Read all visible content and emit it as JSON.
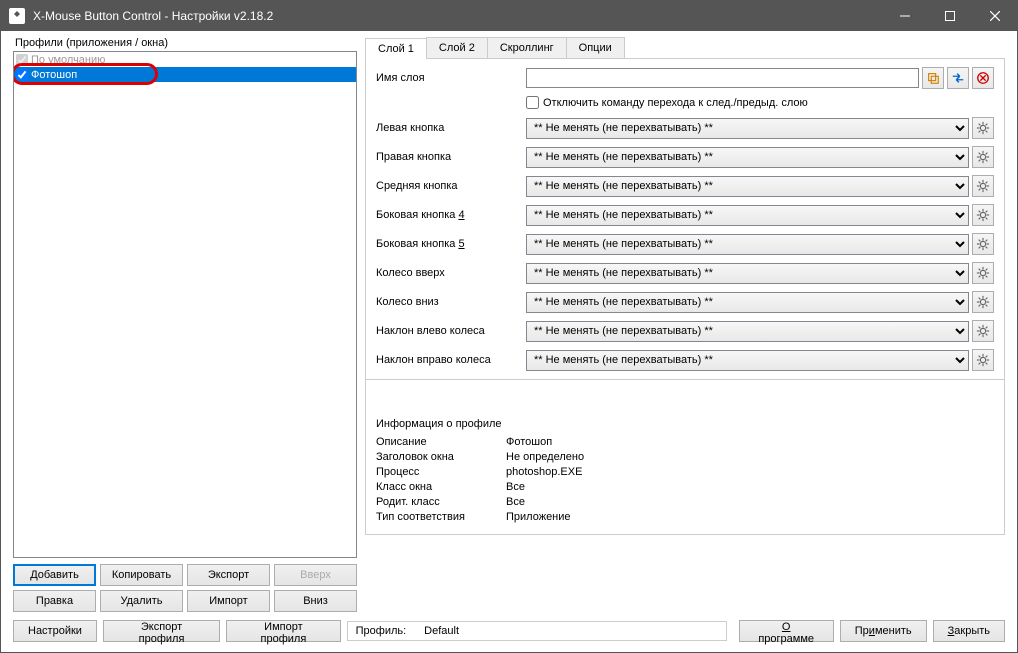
{
  "window": {
    "title": "X-Mouse Button Control - Настройки v2.18.2"
  },
  "left": {
    "label": "Профили (приложения / окна)",
    "items": {
      "default": "По умолчанию",
      "selected": "Фотошоп"
    },
    "buttons": {
      "add": "Добавить",
      "copy": "Копировать",
      "export": "Экспорт",
      "up": "Вверх",
      "edit": "Правка",
      "delete": "Удалить",
      "import": "Импорт",
      "down": "Вниз"
    }
  },
  "tabs": {
    "t1": "Слой 1",
    "t2": "Слой 2",
    "t3": "Скроллинг",
    "t4": "Опции"
  },
  "layer": {
    "name_label": "Имя слоя",
    "disable_cmd": "Отключить команду перехода к след./предыд. слою",
    "rows": {
      "left": "Левая кнопка",
      "right": "Правая кнопка",
      "middle": "Средняя кнопка",
      "side4_pre": "Боковая кнопка ",
      "side4_u": "4",
      "side5_pre": "Боковая кнопка ",
      "side5_u": "5",
      "wheel_up": "Колесо вверх",
      "wheel_down": "Колесо вниз",
      "tilt_left": "Наклон влево колеса",
      "tilt_right": "Наклон вправо колеса"
    },
    "combo_default": "** Не менять (не перехватывать) **"
  },
  "info": {
    "title": "Информация о профиле",
    "rows": {
      "desc_l": "Описание",
      "desc_v": "Фотошоп",
      "wtitle_l": "Заголовок окна",
      "wtitle_v": "Не определено",
      "proc_l": "Процесс",
      "proc_v": "photoshop.EXE",
      "wclass_l": "Класс окна",
      "wclass_v": "Все",
      "pclass_l": "Родит. класс",
      "pclass_v": "Все",
      "match_l": "Тип соответствия",
      "match_v": "Приложение"
    }
  },
  "bottom": {
    "settings": "Настройки",
    "export_profile": "Экспорт профиля",
    "import_profile": "Импорт профиля",
    "profile_label": "Профиль:",
    "profile_value": "Default",
    "about": "О программе",
    "apply": "Применить",
    "close": "Закрыть"
  }
}
